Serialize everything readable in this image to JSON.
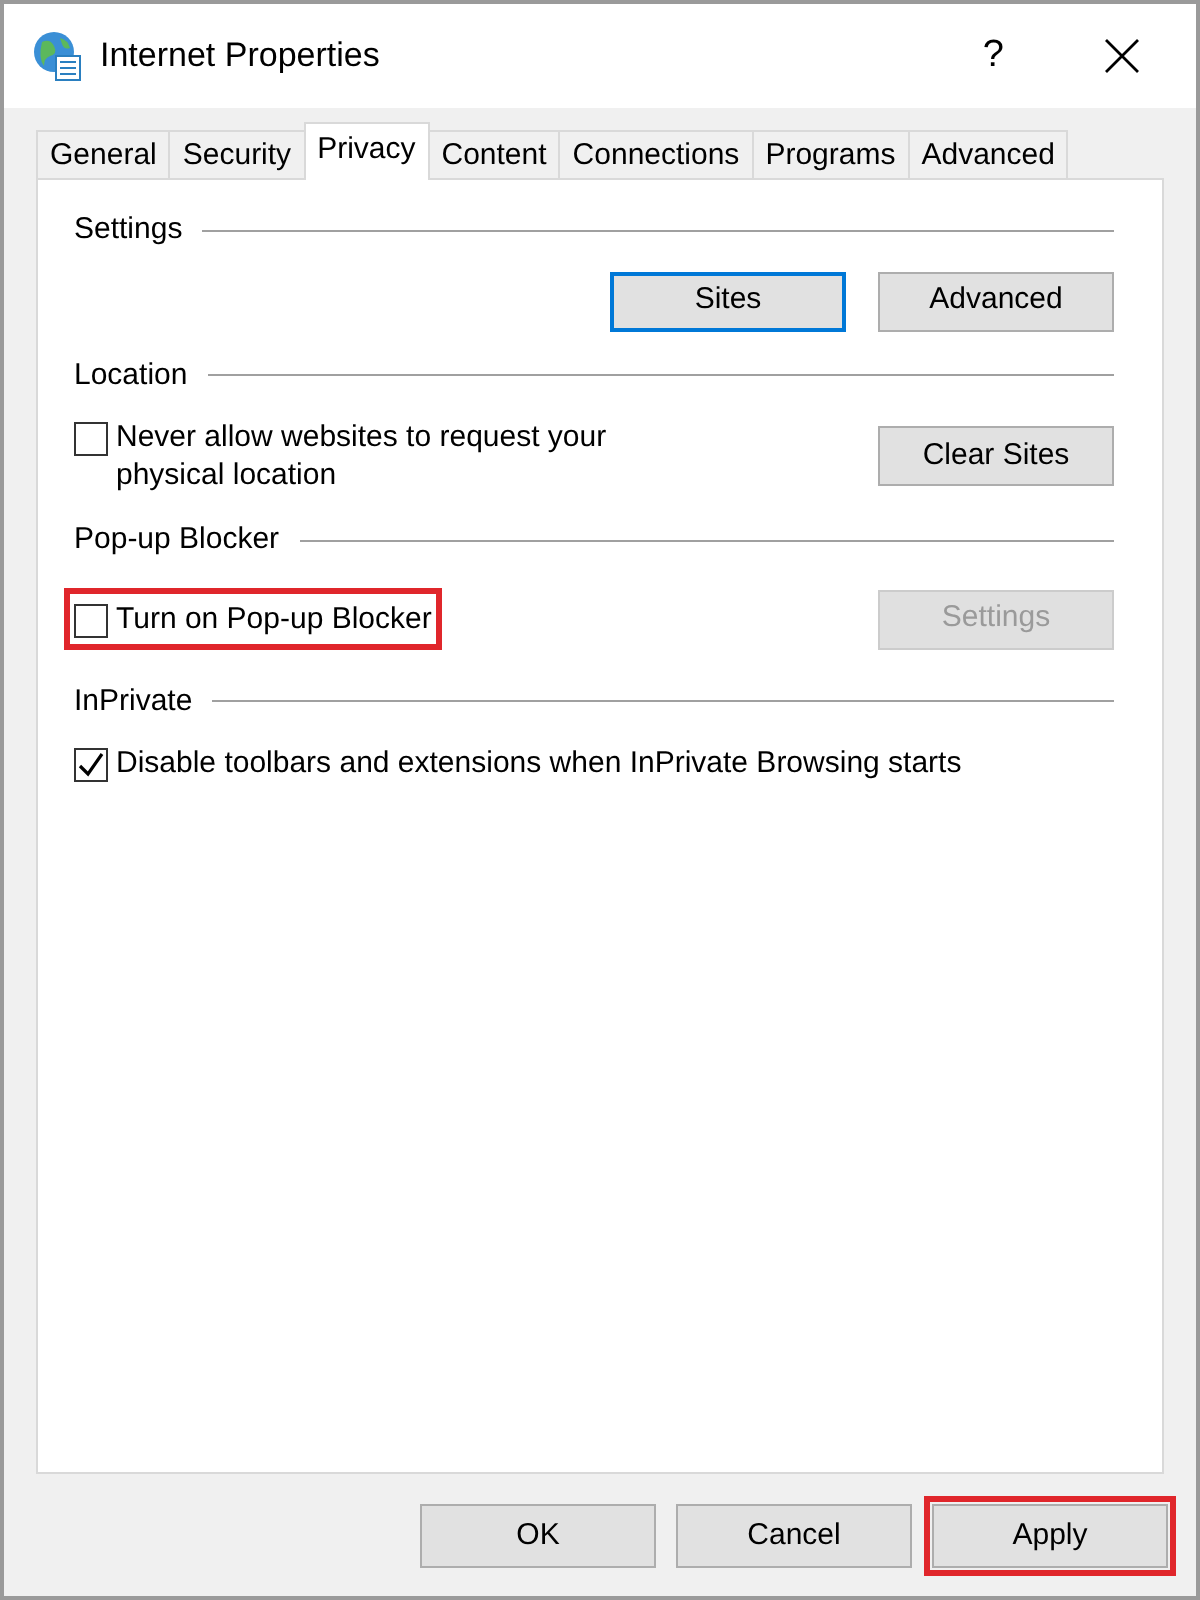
{
  "window": {
    "title": "Internet Properties",
    "help": "?"
  },
  "tabs": [
    {
      "label": "General",
      "selected": false
    },
    {
      "label": "Security",
      "selected": false
    },
    {
      "label": "Privacy",
      "selected": true
    },
    {
      "label": "Content",
      "selected": false
    },
    {
      "label": "Connections",
      "selected": false
    },
    {
      "label": "Programs",
      "selected": false
    },
    {
      "label": "Advanced",
      "selected": false
    }
  ],
  "sections": [
    {
      "heading": "Settings",
      "buttons": [
        {
          "label": "Sites",
          "focused": true,
          "disabled": false
        },
        {
          "label": "Advanced",
          "focused": false,
          "disabled": false
        }
      ]
    },
    {
      "heading": "Location",
      "checkbox": {
        "label": "Never allow websites to request your physical location",
        "checked": false,
        "highlighted": false
      },
      "buttons": [
        {
          "label": "Clear Sites",
          "focused": false,
          "disabled": false
        }
      ]
    },
    {
      "heading": "Pop-up Blocker",
      "checkbox": {
        "label": "Turn on Pop-up Blocker",
        "checked": false,
        "highlighted": true
      },
      "buttons": [
        {
          "label": "Settings",
          "focused": false,
          "disabled": true
        }
      ]
    },
    {
      "heading": "InPrivate",
      "checkbox": {
        "label": "Disable toolbars and extensions when InPrivate Browsing starts",
        "checked": true,
        "highlighted": false
      }
    }
  ],
  "footer_buttons": [
    {
      "label": "OK",
      "highlighted": false
    },
    {
      "label": "Cancel",
      "highlighted": false
    },
    {
      "label": "Apply",
      "highlighted": true
    }
  ]
}
